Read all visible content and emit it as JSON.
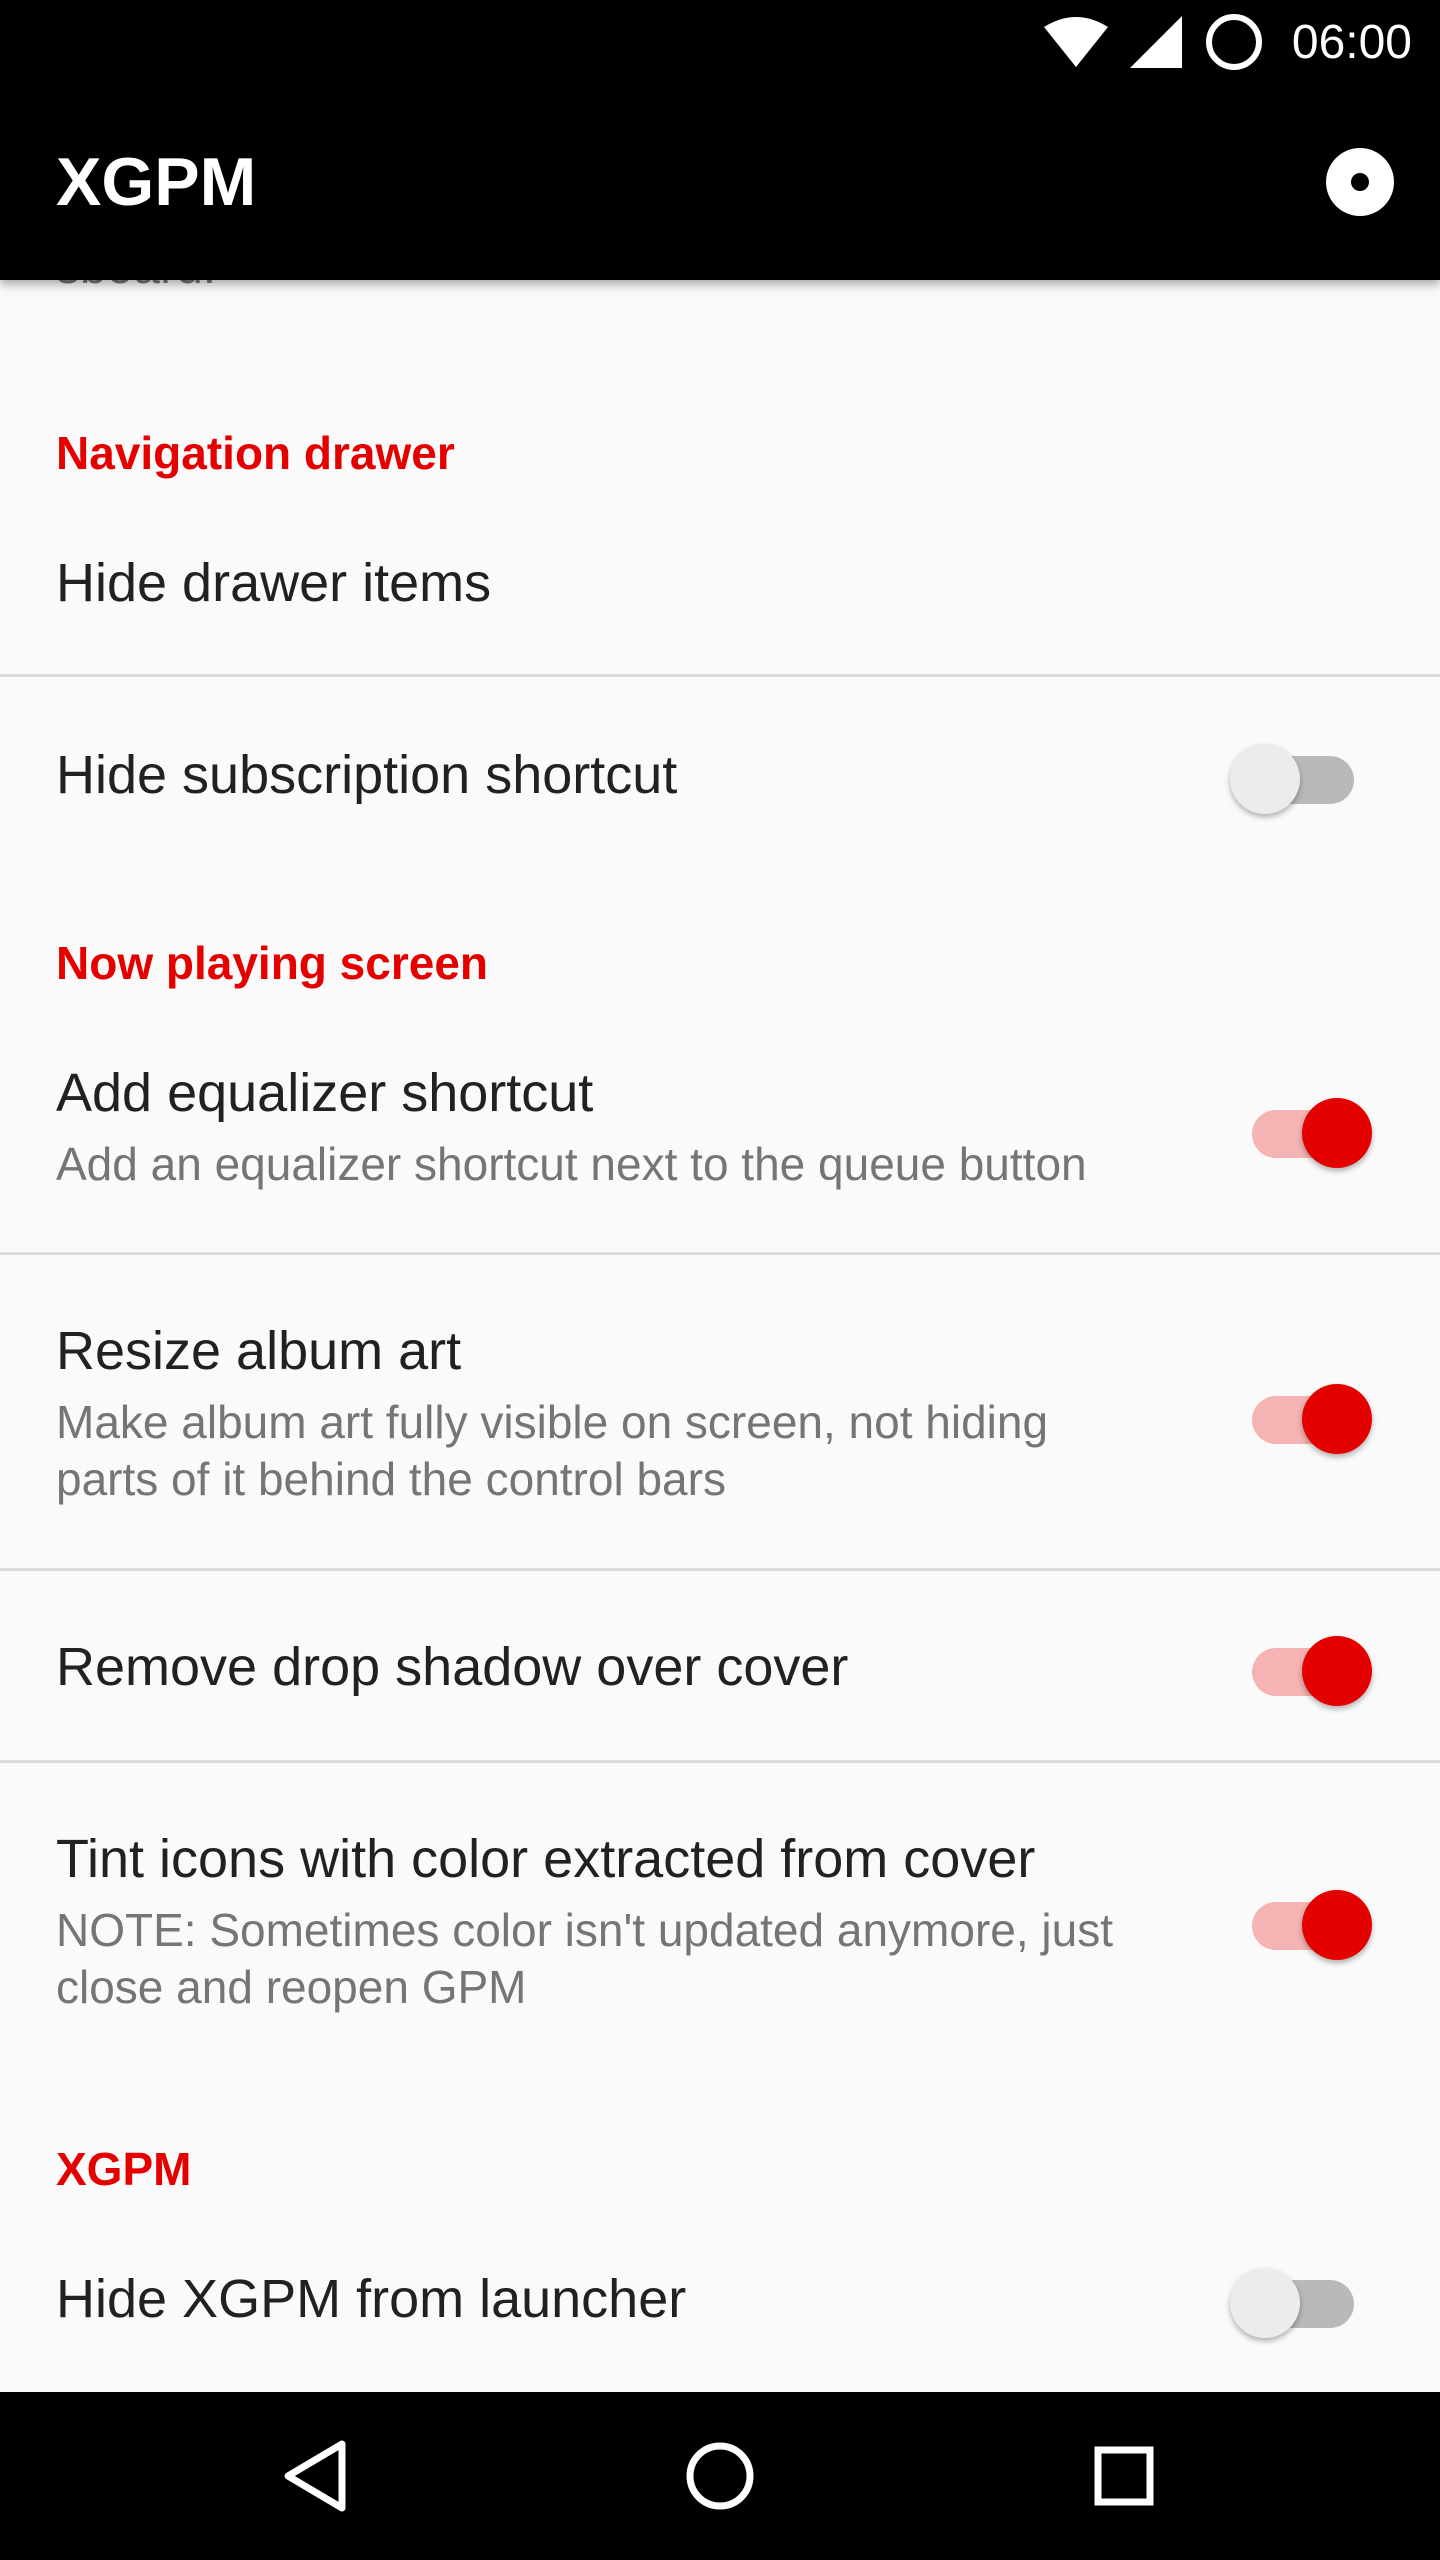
{
  "status_bar": {
    "time": "06:00"
  },
  "app_bar": {
    "title": "XGPM",
    "action_icon": "record-icon"
  },
  "clipped_text": "sboard.",
  "sections": [
    {
      "header": "Navigation drawer"
    },
    {
      "header": "Now playing screen"
    },
    {
      "header": "XGPM"
    }
  ],
  "prefs": [
    {
      "title": "Hide drawer items"
    },
    {
      "title": "Hide subscription shortcut",
      "switch": "off"
    },
    {
      "title": "Add equalizer shortcut",
      "summary": "Add an equalizer shortcut next to the queue button",
      "switch": "on"
    },
    {
      "title": "Resize album art",
      "summary": "Make album art fully visible on screen, not hiding parts of it behind the control bars",
      "switch": "on"
    },
    {
      "title": "Remove drop shadow over cover",
      "switch": "on"
    },
    {
      "title": "Tint icons with color extracted from cover",
      "summary": "NOTE: Sometimes color isn't updated anymore, just close and reopen GPM",
      "switch": "on"
    },
    {
      "title": "Hide XGPM from launcher",
      "switch": "off"
    }
  ],
  "colors": {
    "accent": "#e50000",
    "app_bar": "#000000",
    "background": "#fafafa"
  },
  "nav_bar": {
    "back_icon": "back-triangle-icon",
    "home_icon": "home-circle-icon",
    "recents_icon": "recents-square-icon"
  }
}
